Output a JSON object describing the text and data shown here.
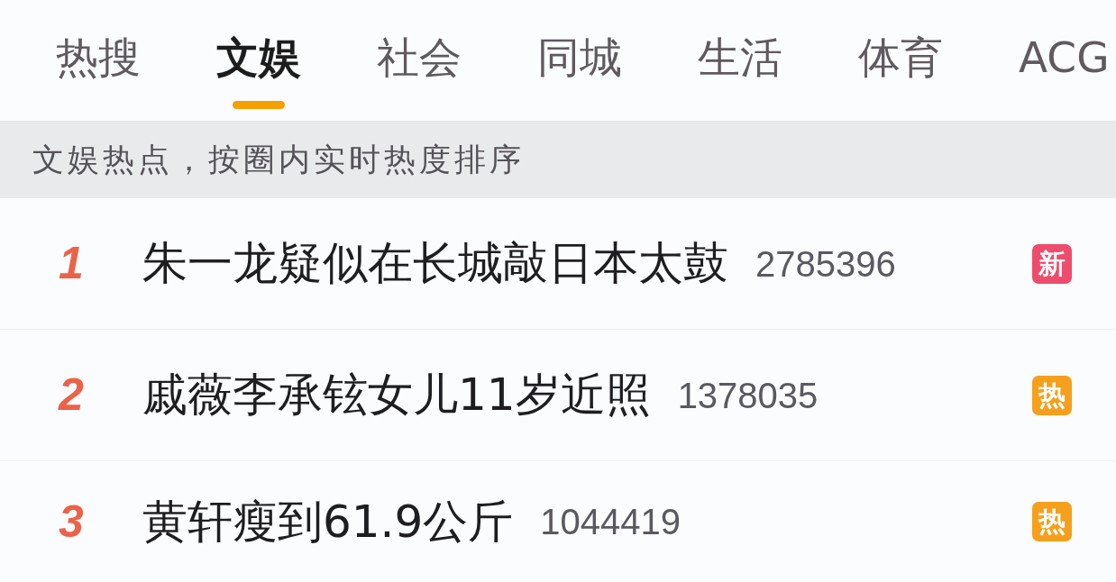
{
  "tabs": [
    {
      "label": "热搜",
      "selected": false
    },
    {
      "label": "文娱",
      "selected": true
    },
    {
      "label": "社会",
      "selected": false
    },
    {
      "label": "同城",
      "selected": false
    },
    {
      "label": "生活",
      "selected": false
    },
    {
      "label": "体育",
      "selected": false
    },
    {
      "label": "ACG",
      "selected": false
    }
  ],
  "banner": {
    "text": "文娱热点，按圈内实时热度排序"
  },
  "entries": [
    {
      "rank": "1",
      "title": "朱一龙疑似在长城敲日本太鼓",
      "count": "2785396",
      "tag": {
        "label": "新",
        "color": "#ee4c6c"
      }
    },
    {
      "rank": "2",
      "title": "戚薇李承铉女儿11岁近照",
      "count": "1378035",
      "tag": {
        "label": "热",
        "color": "#f5a01c"
      }
    },
    {
      "rank": "3",
      "title": "黄轩瘦到61.9公斤",
      "count": "1044419",
      "tag": {
        "label": "热",
        "color": "#f5a01c"
      }
    }
  ]
}
